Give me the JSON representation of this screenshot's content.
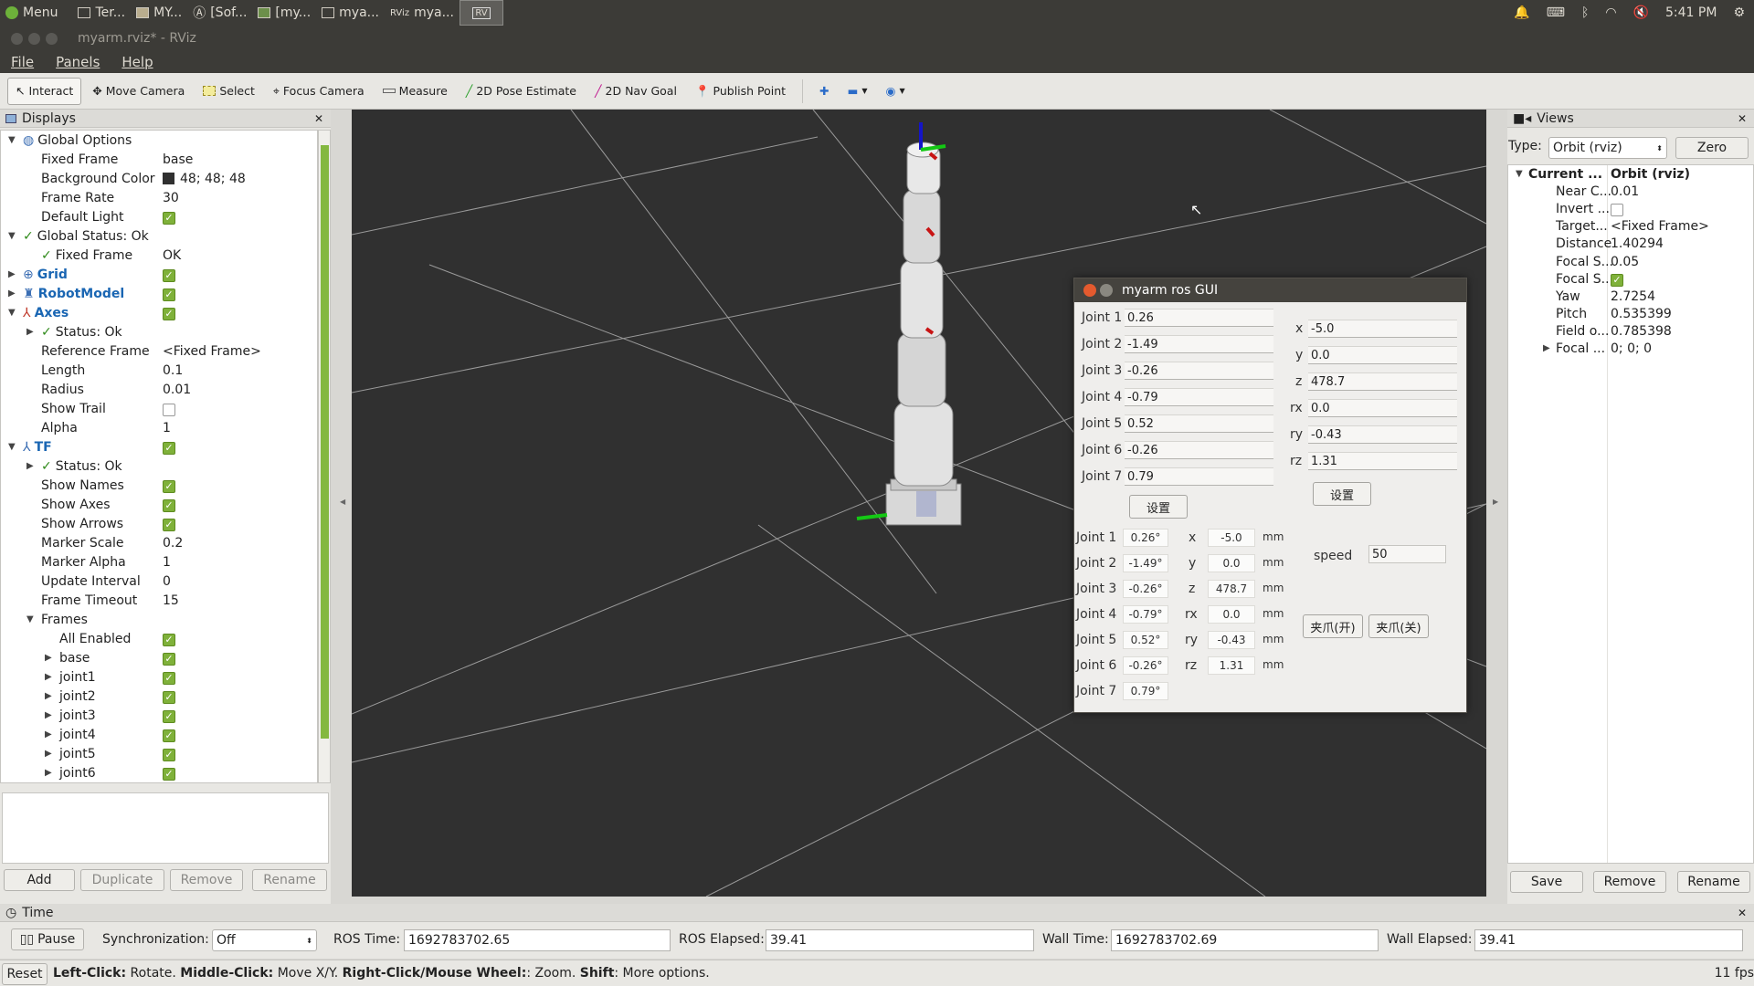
{
  "top_panel": {
    "menu": "Menu",
    "tasks": [
      "Ter...",
      "MY...",
      "[Sof...",
      "[my...",
      "mya...",
      "mya..."
    ],
    "clock": "5:41 PM"
  },
  "window": {
    "title": "myarm.rviz* - RViz"
  },
  "menubar": {
    "file": "File",
    "panels": "Panels",
    "help": "Help"
  },
  "toolbar": {
    "interact": "Interact",
    "move_camera": "Move Camera",
    "select": "Select",
    "focus_camera": "Focus Camera",
    "measure": "Measure",
    "pose_estimate": "2D Pose Estimate",
    "nav_goal": "2D Nav Goal",
    "publish_point": "Publish Point"
  },
  "displays": {
    "title": "Displays",
    "rows": [
      {
        "name": "Global Options",
        "value": ""
      },
      {
        "name": "Fixed Frame",
        "value": "base"
      },
      {
        "name": "Background Color",
        "value": "48; 48; 48"
      },
      {
        "name": "Frame Rate",
        "value": "30"
      },
      {
        "name": "Default Light",
        "value": ""
      },
      {
        "name": "Global Status: Ok",
        "value": ""
      },
      {
        "name": "Fixed Frame",
        "value": "OK"
      },
      {
        "name": "Grid",
        "value": ""
      },
      {
        "name": "RobotModel",
        "value": ""
      },
      {
        "name": "Axes",
        "value": ""
      },
      {
        "name": "Status: Ok",
        "value": ""
      },
      {
        "name": "Reference Frame",
        "value": "<Fixed Frame>"
      },
      {
        "name": "Length",
        "value": "0.1"
      },
      {
        "name": "Radius",
        "value": "0.01"
      },
      {
        "name": "Show Trail",
        "value": ""
      },
      {
        "name": "Alpha",
        "value": "1"
      },
      {
        "name": "TF",
        "value": ""
      },
      {
        "name": "Status: Ok",
        "value": ""
      },
      {
        "name": "Show Names",
        "value": ""
      },
      {
        "name": "Show Axes",
        "value": ""
      },
      {
        "name": "Show Arrows",
        "value": ""
      },
      {
        "name": "Marker Scale",
        "value": "0.2"
      },
      {
        "name": "Marker Alpha",
        "value": "1"
      },
      {
        "name": "Update Interval",
        "value": "0"
      },
      {
        "name": "Frame Timeout",
        "value": "15"
      },
      {
        "name": "Frames",
        "value": ""
      },
      {
        "name": "All Enabled",
        "value": ""
      },
      {
        "name": "base",
        "value": ""
      },
      {
        "name": "joint1",
        "value": ""
      },
      {
        "name": "joint2",
        "value": ""
      },
      {
        "name": "joint3",
        "value": ""
      },
      {
        "name": "joint4",
        "value": ""
      },
      {
        "name": "joint5",
        "value": ""
      },
      {
        "name": "joint6",
        "value": ""
      }
    ],
    "buttons": {
      "add": "Add",
      "duplicate": "Duplicate",
      "remove": "Remove",
      "rename": "Rename"
    }
  },
  "gui": {
    "title": "myarm ros GUI",
    "joint_labels": [
      "Joint 1",
      "Joint 2",
      "Joint 3",
      "Joint 4",
      "Joint 5",
      "Joint 6",
      "Joint 7"
    ],
    "joint_inputs": [
      "0.26",
      "-1.49",
      "-0.26",
      "-0.79",
      "0.52",
      "-0.26",
      "0.79"
    ],
    "coord_labels": [
      "x",
      "y",
      "z",
      "rx",
      "ry",
      "rz"
    ],
    "coord_inputs": [
      "-5.0",
      "0.0",
      "478.7",
      "0.0",
      "-0.43",
      "1.31"
    ],
    "set_label": "设置",
    "joint_readouts": [
      "0.26°",
      "-1.49°",
      "-0.26°",
      "-0.79°",
      "0.52°",
      "-0.26°",
      "0.79°"
    ],
    "coord_readouts": [
      "-5.0",
      "0.0",
      "478.7",
      "0.0",
      "-0.43",
      "1.31"
    ],
    "unit": "mm",
    "speed_label": "speed",
    "speed_value": "50",
    "gripper_open": "夹爪(开)",
    "gripper_close": "夹爪(关)"
  },
  "views": {
    "title": "Views",
    "type_label": "Type:",
    "type_value": "Orbit (rviz)",
    "zero": "Zero",
    "rows": [
      {
        "name": "Current ...",
        "value": "Orbit (rviz)"
      },
      {
        "name": "Near C...",
        "value": "0.01"
      },
      {
        "name": "Invert ...",
        "value": ""
      },
      {
        "name": "Target...",
        "value": "<Fixed Frame>"
      },
      {
        "name": "Distance",
        "value": "1.40294"
      },
      {
        "name": "Focal S...",
        "value": "0.05"
      },
      {
        "name": "Focal S...",
        "value": ""
      },
      {
        "name": "Yaw",
        "value": "2.7254"
      },
      {
        "name": "Pitch",
        "value": "0.535399"
      },
      {
        "name": "Field o...",
        "value": "0.785398"
      },
      {
        "name": "Focal ...",
        "value": "0; 0; 0"
      }
    ],
    "buttons": {
      "save": "Save",
      "remove": "Remove",
      "rename": "Rename"
    }
  },
  "time": {
    "title": "Time",
    "pause": "Pause",
    "sync_label": "Synchronization:",
    "sync_value": "Off",
    "ros_time_label": "ROS Time:",
    "ros_time": "1692783702.65",
    "ros_elapsed_label": "ROS Elapsed:",
    "ros_elapsed": "39.41",
    "wall_time_label": "Wall Time:",
    "wall_time": "1692783702.69",
    "wall_elapsed_label": "Wall Elapsed:",
    "wall_elapsed": "39.41"
  },
  "status": {
    "reset": "Reset",
    "hint_b1": "Left-Click:",
    "hint_t1": " Rotate. ",
    "hint_b2": "Middle-Click:",
    "hint_t2": " Move X/Y. ",
    "hint_b3": "Right-Click/Mouse Wheel:",
    "hint_t3": ": Zoom. ",
    "hint_b4": "Shift",
    "hint_t4": ": More options.",
    "fps": "11 fps"
  }
}
